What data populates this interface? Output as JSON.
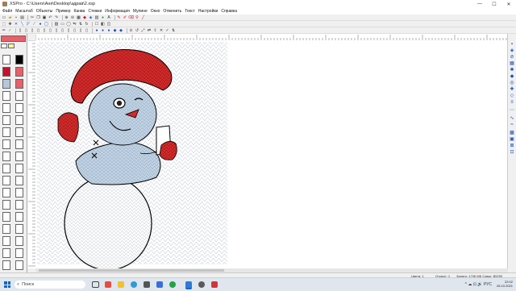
{
  "window": {
    "title": "XSPro - C:\\Users\\Аня\\Desktop\\здрав\\2.xsp",
    "minimize_glyph": "—",
    "maximize_glyph": "☐",
    "close_glyph": "✕"
  },
  "menu": {
    "items": [
      "Файл",
      "Масштаб",
      "Объекты",
      "Пример",
      "Канва",
      "Стежки",
      "Информация",
      "Мулине",
      "Окно",
      "Отменить",
      "Текст",
      "Настройки",
      "Справка"
    ]
  },
  "palette": {
    "swatch_colors": [
      "#ffffff",
      "#000000",
      "#c8102e",
      "#b4c8dc",
      "#e8606a"
    ]
  },
  "workspace": {
    "ruler_top_label": "1",
    "ruler_left_label": "10"
  },
  "status": {
    "left_text": "Цвета: 1",
    "middle_text": "Открыт: 1",
    "right_text": "Занято: 1706 МБ Сдвиг: B5290"
  },
  "taskbar": {
    "search_placeholder": "Поиск",
    "tray_icons": "^ ☁ ⊡ 🔊 РУС",
    "time": "22:02",
    "date": "26.10.2021"
  },
  "colors": {
    "hat_red": "#d42b2b",
    "body_blue": "#b8cde0",
    "accent_blue": "#1a4fb8",
    "taskbar_bg": "#dfe6ee"
  }
}
